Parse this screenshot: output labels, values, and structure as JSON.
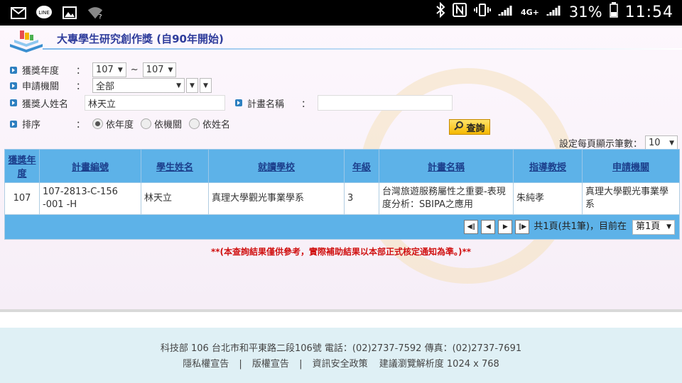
{
  "status_bar": {
    "battery": "31%",
    "time": "11:54",
    "carrier_4g": "4G+"
  },
  "header": {
    "title": "大專學生研究創作獎 (自90年開始)"
  },
  "form": {
    "year_label": "獲獎年度",
    "year_from": "107",
    "year_sep": "~",
    "year_to": "107",
    "agency_label": "申請機關",
    "agency_value": "全部",
    "name_label": "獲獎人姓名",
    "name_value": "林天立",
    "plan_label": "計畫名稱",
    "plan_value": "",
    "sort_label": "排序",
    "colon": "：",
    "sort_options": [
      "依年度",
      "依機關",
      "依姓名"
    ],
    "query_button": "查詢",
    "per_page_label": "設定每頁顯示筆數：",
    "per_page_value": "10"
  },
  "table": {
    "headers": [
      "獲獎年度",
      "計畫編號",
      "學生姓名",
      "就讀學校",
      "年級",
      "計畫名稱",
      "指導教授",
      "申請機關"
    ],
    "rows": [
      [
        "107",
        "107-2813-C-156 -001 -H",
        "林天立",
        "真理大學觀光事業學系",
        "3",
        "台灣旅遊服務屬性之重要-表現度分析：SBIPA之應用",
        "朱純孝",
        "真理大學觀光事業學系"
      ]
    ],
    "pager_text": "共1頁(共1筆)，目前在",
    "page_select": "第1頁"
  },
  "disclaimer": "**(本查詢結果僅供參考，實際補助結果以本部正式核定通知為準。)**",
  "footer": {
    "address": "科技部  106  台北市和平東路二段106號  電話：(02)2737-7592  傳真：(02)2737-7691",
    "links": [
      "隱私權宣告",
      "版權宣告",
      "資訊安全政策"
    ],
    "resolution_note": "建議瀏覽解析度 1024 x 768"
  }
}
